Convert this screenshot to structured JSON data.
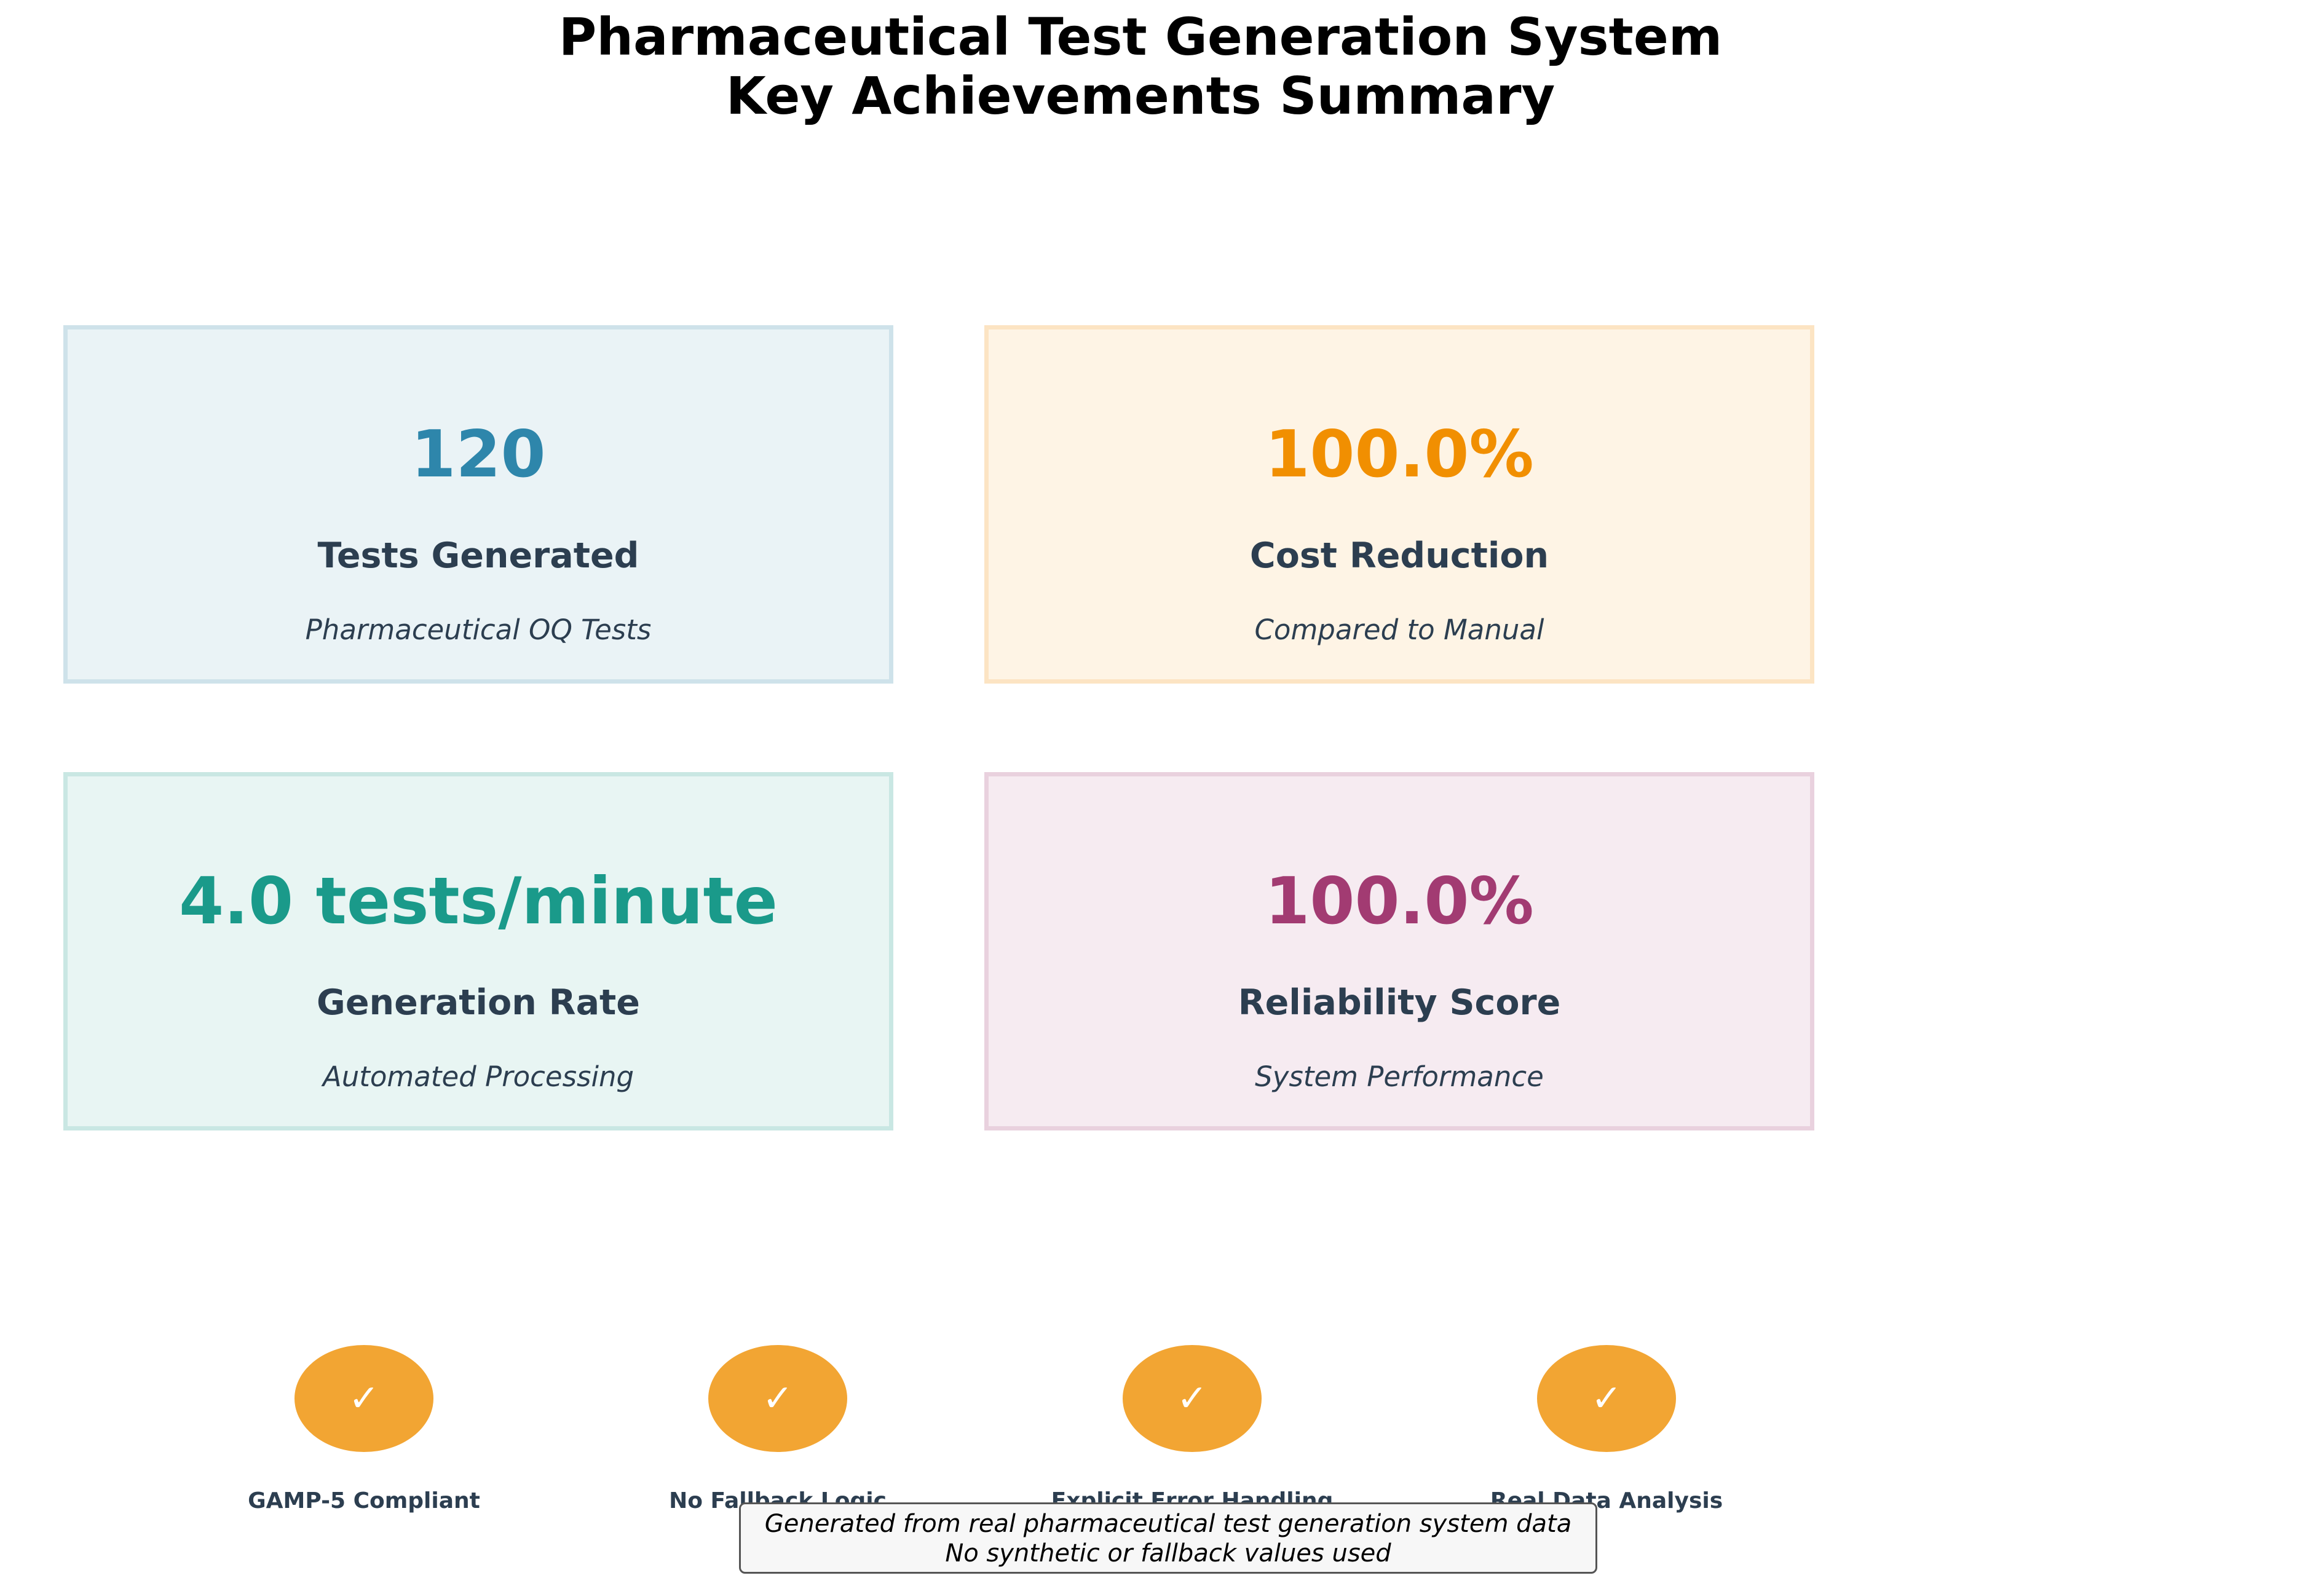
{
  "chart_data": {
    "type": "table",
    "title": "Pharmaceutical Test Generation System",
    "subtitle": "Key Achievements Summary",
    "metrics": [
      {
        "value": "120",
        "label": "Tests Generated",
        "description": "Pharmaceutical OQ Tests",
        "color": "#2e86ab"
      },
      {
        "value": "100.0%",
        "label": "Cost Reduction",
        "description": "Compared to Manual",
        "color": "#f18f01"
      },
      {
        "value": "4.0 tests/minute",
        "label": "Generation Rate",
        "description": "Automated Processing",
        "color": "#1a9a8a"
      },
      {
        "value": "100.0%",
        "label": "Reliability Score",
        "description": "System Performance",
        "color": "#a23b72"
      }
    ],
    "badges": [
      {
        "icon": "checkmark-icon",
        "symbol": "✓",
        "label": "GAMP-5 Compliant"
      },
      {
        "icon": "checkmark-icon",
        "symbol": "✓",
        "label": "No Fallback Logic"
      },
      {
        "icon": "checkmark-icon",
        "symbol": "✓",
        "label": "Explicit Error Handling"
      },
      {
        "icon": "checkmark-icon",
        "symbol": "✓",
        "label": "Real Data Analysis"
      }
    ],
    "badge_color": "#f2a533",
    "footer": {
      "line1": "Generated from real pharmaceutical test generation system data",
      "line2": "No synthetic or fallback values used"
    }
  }
}
